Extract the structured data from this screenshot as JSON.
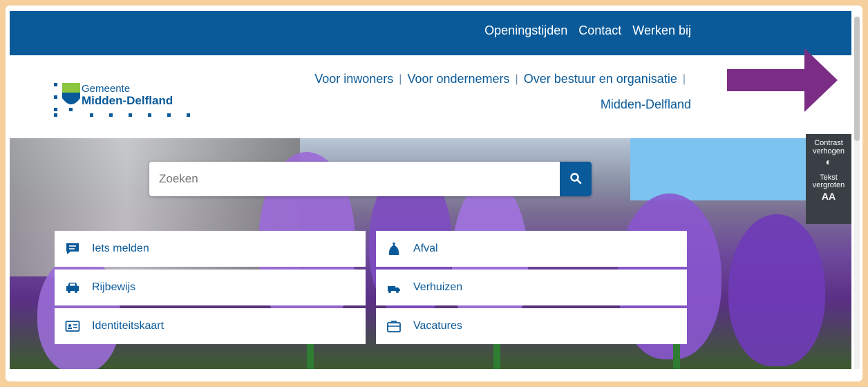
{
  "topbar": {
    "links": [
      "Openingstijden",
      "Contact",
      "Werken bij"
    ]
  },
  "logo": {
    "line1": "Gemeente",
    "line2": "Midden-Delfland"
  },
  "mainnav": {
    "items": [
      "Voor inwoners",
      "Voor ondernemers",
      "Over bestuur en organisatie",
      "Midden-Delfland"
    ],
    "separator": "|"
  },
  "search": {
    "placeholder": "Zoeken",
    "icon": "search-icon"
  },
  "tiles": [
    {
      "label": "Iets melden",
      "icon": "chat-icon"
    },
    {
      "label": "Afval",
      "icon": "trash-bag-icon"
    },
    {
      "label": "Rijbewijs",
      "icon": "car-icon"
    },
    {
      "label": "Verhuizen",
      "icon": "moving-truck-icon"
    },
    {
      "label": "Identiteitskaart",
      "icon": "id-card-icon"
    },
    {
      "label": "Vacatures",
      "icon": "briefcase-icon"
    }
  ],
  "accessibility": {
    "contrast_label": "Contrast verhogen",
    "contrast_symbol": "◐",
    "text_label": "Tekst vergroten",
    "text_symbol": "AA"
  },
  "colors": {
    "brand_blue": "#0a5a9a",
    "frame_bg": "#f5cf9c",
    "arrow": "#7b2d86",
    "a11y_panel": "#3a3f45"
  }
}
